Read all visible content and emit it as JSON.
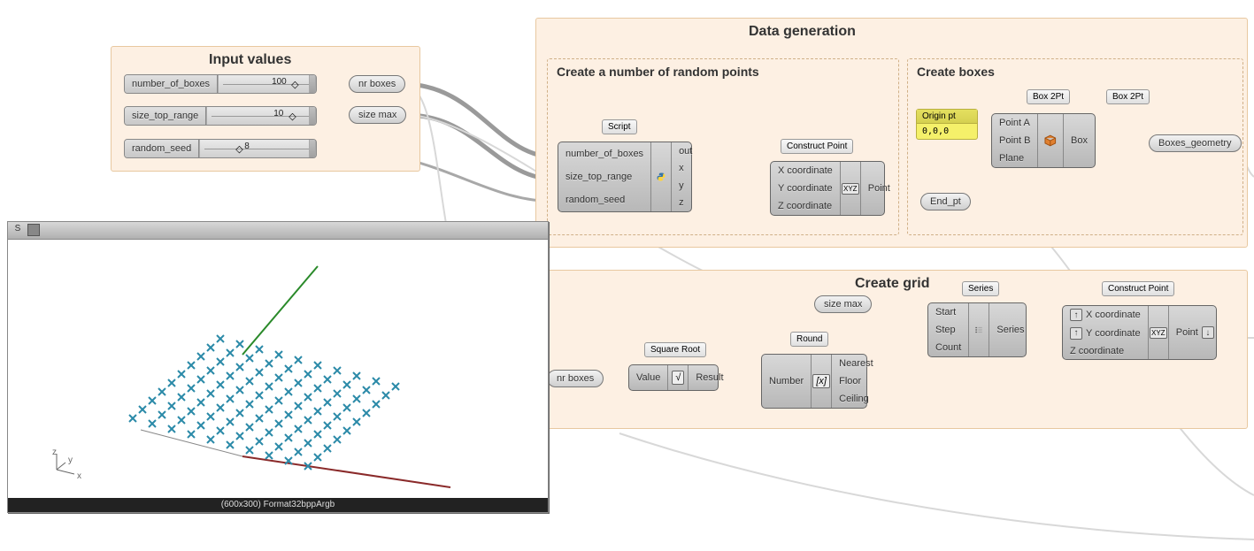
{
  "groups": {
    "input_values": {
      "title": "Input values"
    },
    "data_generation": {
      "title": "Data generation"
    },
    "random_points": {
      "title": "Create a number of random points"
    },
    "create_boxes": {
      "title": "Create boxes"
    },
    "create_grid": {
      "title": "Create grid"
    }
  },
  "sliders": {
    "boxes": {
      "label": "number_of_boxes",
      "value": "100"
    },
    "size": {
      "label": "size_top_range",
      "value": "10"
    },
    "seed": {
      "label": "random_seed",
      "value": "8"
    }
  },
  "params": {
    "nr_boxes": "nr boxes",
    "size_max": "size max",
    "end_pt": "End_pt",
    "boxes_geometry": "Boxes_geometry",
    "nr_boxes2": "nr boxes",
    "size_max2": "size max"
  },
  "tags": {
    "script": "Script",
    "construct_point": "Construct Point",
    "box2pt_a": "Box 2Pt",
    "box2pt_b": "Box 2Pt",
    "series": "Series",
    "construct_point2": "Construct Point",
    "sqrt": "Square Root",
    "round": "Round"
  },
  "panel": {
    "header": "Origin pt",
    "body": "0,0,0"
  },
  "script_comp": {
    "inputs": [
      "number_of_boxes",
      "size_top_range",
      "random_seed"
    ],
    "outputs": [
      "out",
      "x",
      "y",
      "z"
    ]
  },
  "construct_point": {
    "inputs": [
      "X coordinate",
      "Y coordinate",
      "Z coordinate"
    ],
    "output": "Point"
  },
  "box2pt": {
    "inputs": [
      "Point A",
      "Point B",
      "Plane"
    ],
    "output": "Box"
  },
  "sqrt": {
    "input": "Value",
    "output": "Result",
    "icon": "√"
  },
  "round": {
    "input": "Number",
    "outputs": [
      "Nearest",
      "Floor",
      "Ceiling"
    ],
    "icon": "[x]"
  },
  "series": {
    "inputs": [
      "Start",
      "Step",
      "Count"
    ],
    "output": "Series"
  },
  "construct_point2": {
    "inputs": [
      "X coordinate",
      "Y coordinate",
      "Z coordinate"
    ],
    "output": "Point"
  },
  "viewport": {
    "footer": "(600x300) Format32bppArgb",
    "tab": "S"
  },
  "axis_labels": {
    "x": "x",
    "y": "y",
    "z": "z"
  }
}
